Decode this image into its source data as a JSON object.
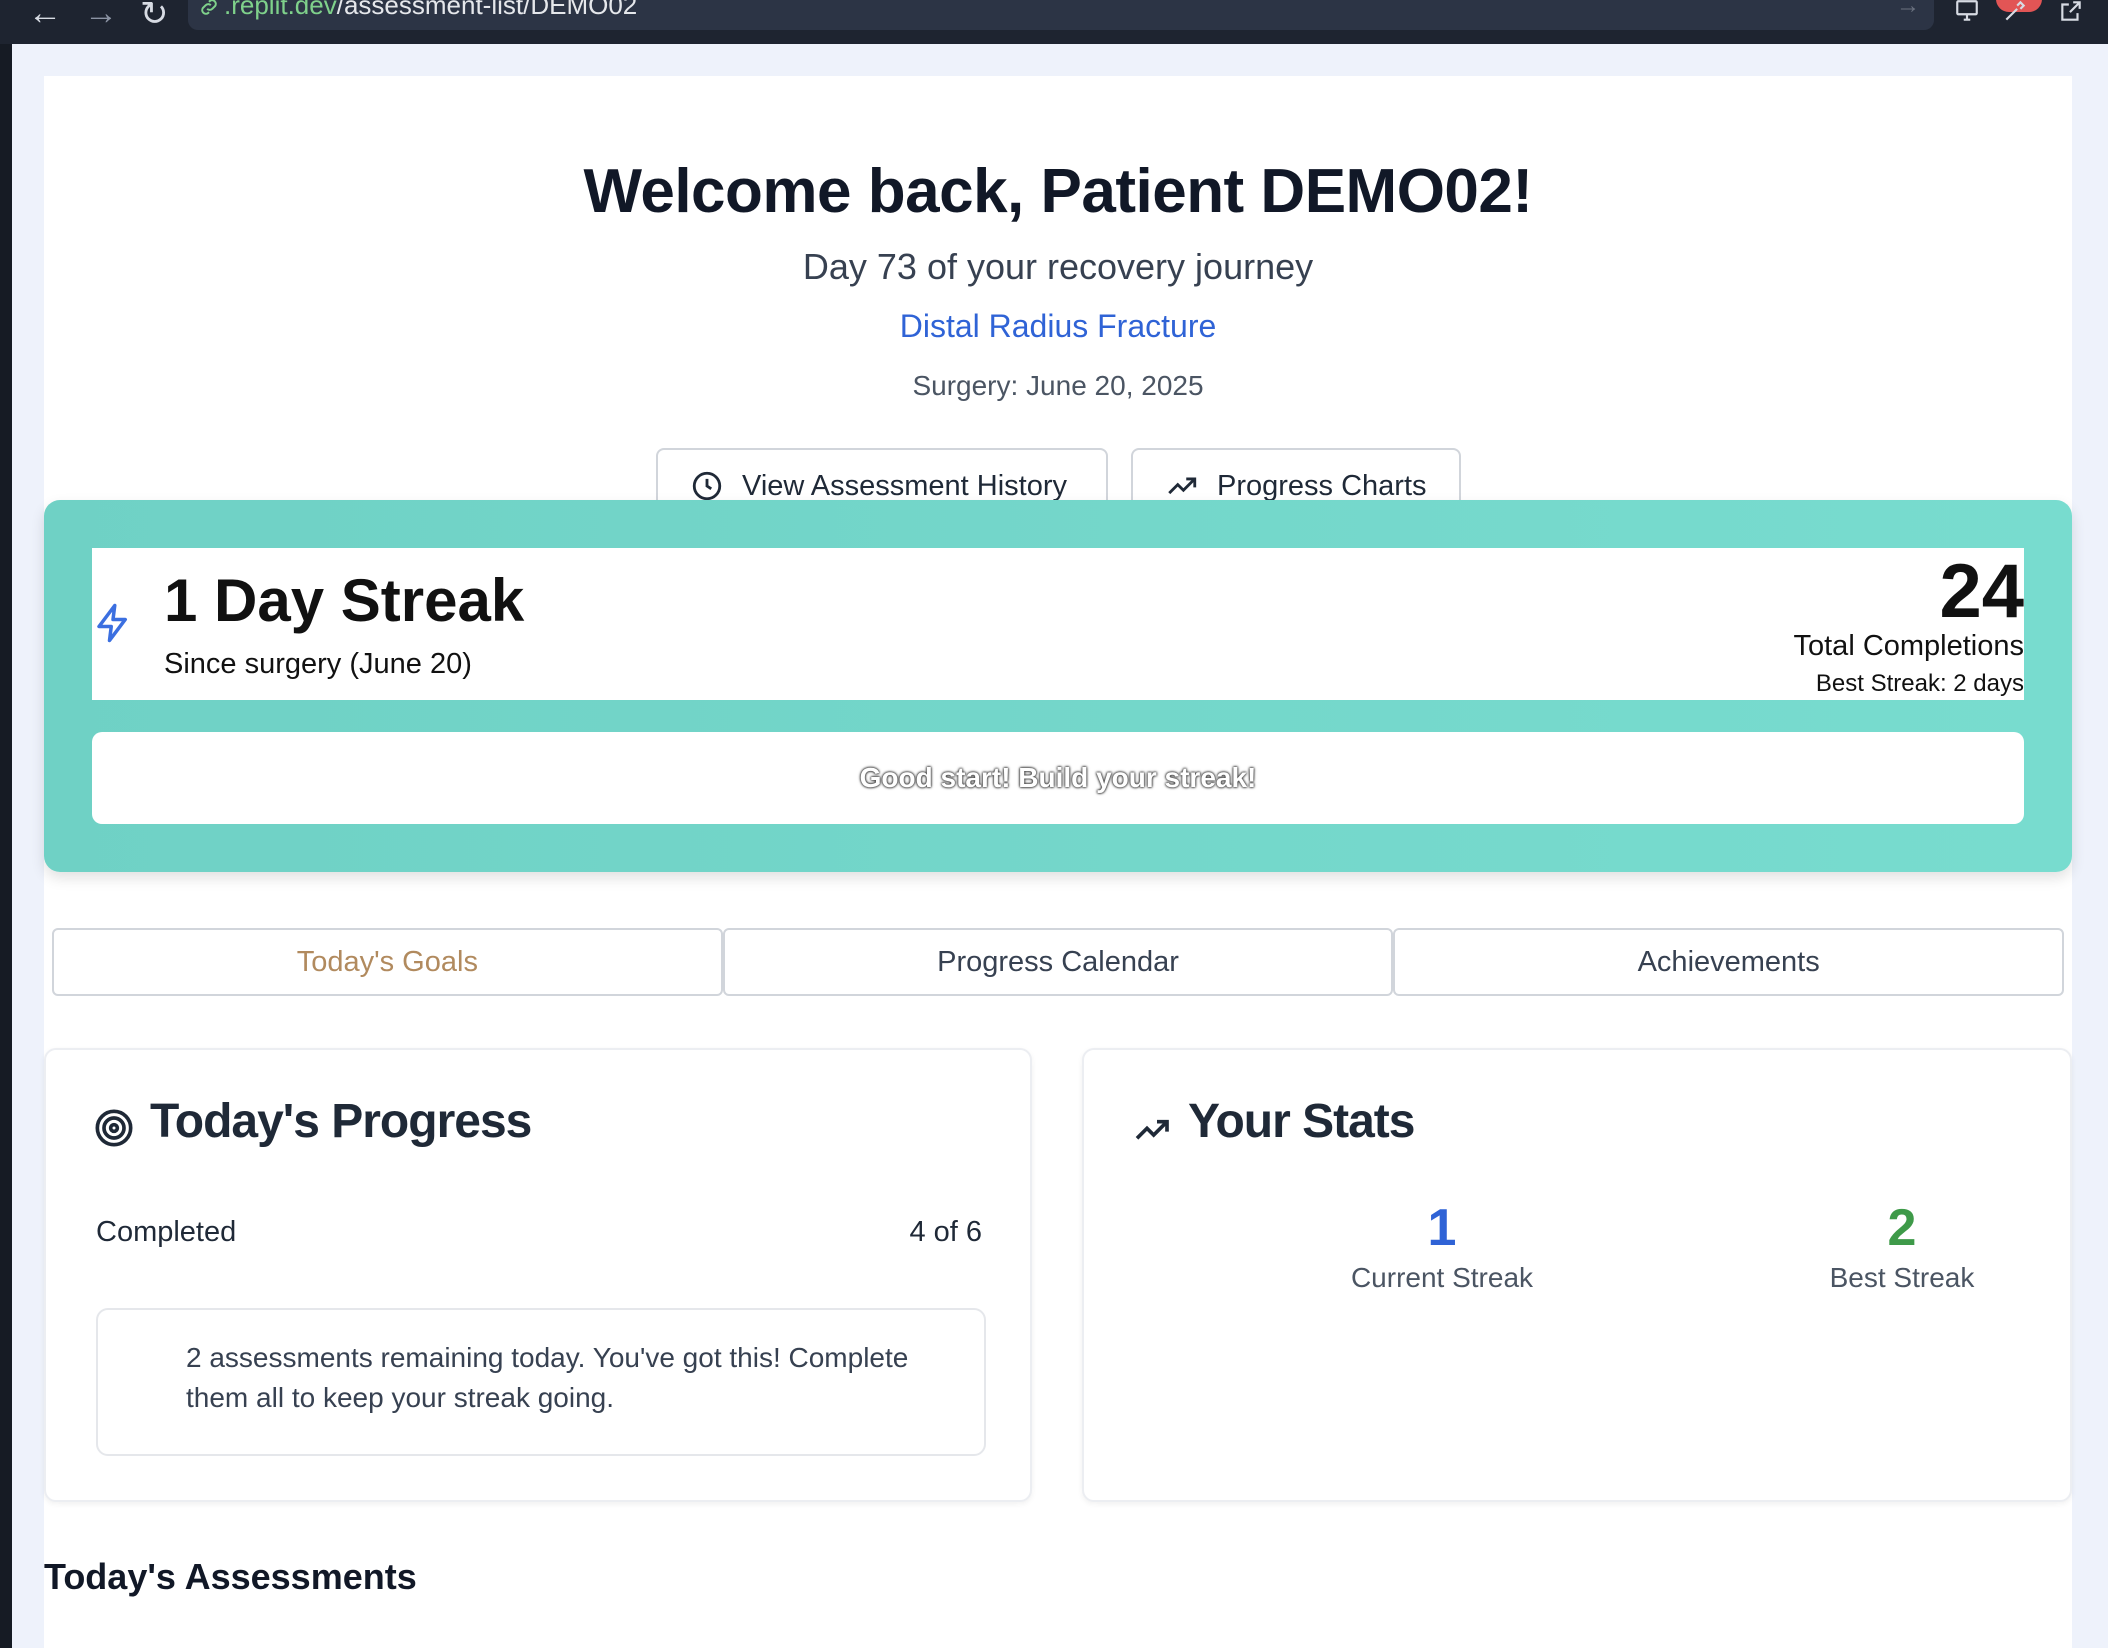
{
  "browser": {
    "url_host": ".replit.dev",
    "url_path": "/assessment-list/DEMO02"
  },
  "header": {
    "welcome": "Welcome back, Patient DEMO02!",
    "day_text": "Day 73 of your recovery journey",
    "condition": "Distal Radius Fracture",
    "surgery": "Surgery: June 20, 2025"
  },
  "actions": {
    "history_label": "View Assessment History",
    "charts_label": "Progress Charts"
  },
  "streak": {
    "title": "1 Day Streak",
    "since": "Since surgery (June 20)",
    "total_completions": "24",
    "total_label": "Total Completions",
    "best_streak": "Best Streak: 2 days",
    "message": "Good start! Build your streak!"
  },
  "tabs": [
    {
      "label": "Today's Goals",
      "active": true
    },
    {
      "label": "Progress Calendar",
      "active": false
    },
    {
      "label": "Achievements",
      "active": false
    }
  ],
  "progress": {
    "title": "Today's Progress",
    "completed_label": "Completed",
    "completed_value": "4 of 6",
    "note": "2 assessments remaining today. You've got this! Complete them all to keep your streak going."
  },
  "stats": {
    "title": "Your Stats",
    "current_streak": "1",
    "current_label": "Current Streak",
    "best_streak": "2",
    "best_label": "Best Streak"
  },
  "assessments": {
    "title": "Today's Assessments"
  },
  "colors": {
    "accent_blue": "#2f63d6",
    "accent_green": "#3e9a49",
    "teal": "#72d8cb",
    "active_tab": "#b18a5e"
  }
}
